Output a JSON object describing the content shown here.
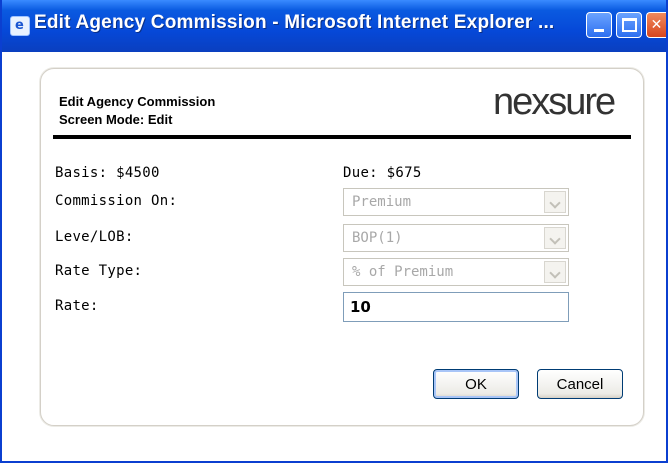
{
  "window": {
    "title": "Edit Agency Commission - Microsoft Internet Explorer ...",
    "icons": {
      "app": "ie-page-icon",
      "minimize": "minimize-icon",
      "maximize": "maximize-icon",
      "close": "close-icon"
    }
  },
  "header": {
    "title": "Edit Agency Commission",
    "subtitle": "Screen Mode: Edit",
    "logo_text": "nexsure"
  },
  "form": {
    "basis": "Basis: $4500",
    "due": "Due: $675",
    "commission_on": {
      "label": "Commission On:",
      "value": "Premium"
    },
    "level_lob": {
      "label": "Leve/LOB:",
      "value": "BOP(1)"
    },
    "rate_type": {
      "label": "Rate Type:",
      "value": "% of Premium"
    },
    "rate": {
      "label": "Rate:",
      "value": "10"
    }
  },
  "buttons": {
    "ok": "OK",
    "cancel": "Cancel"
  },
  "colors": {
    "titlebar": "#0648d8",
    "frame": "#0b3fd0",
    "disabled_text": "#a8a8a8",
    "input_border": "#7f9db9"
  }
}
